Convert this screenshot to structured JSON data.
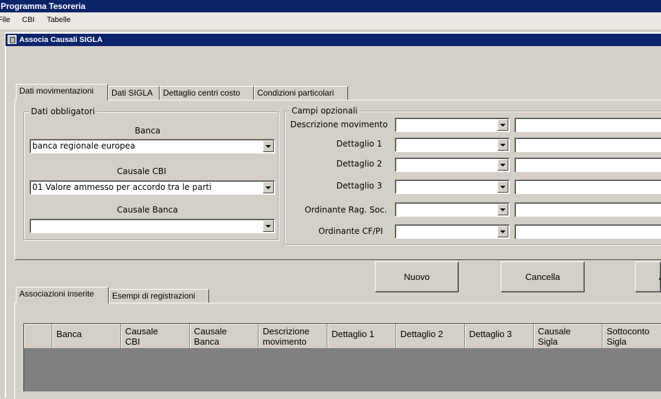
{
  "app": {
    "title": "Programma Tesoreria"
  },
  "menu": {
    "items": [
      "File",
      "CBI",
      "Tabelle"
    ]
  },
  "window": {
    "title": "Associa Causali SIGLA"
  },
  "tabs_top": [
    "Dati movimentazioni",
    "Dati SIGLA",
    "Dettaglio centri costo",
    "Condizioni particolari"
  ],
  "mandatory": {
    "title": "Dati obbligatori",
    "banca_label": "Banca",
    "banca_value": "banca  regionale europea",
    "causale_cbi_label": "Causale CBI",
    "causale_cbi_value": "01 Valore ammesso per accordo tra le parti",
    "causale_banca_label": "Causale Banca",
    "causale_banca_value": ""
  },
  "optional": {
    "title": "Campi opzionali",
    "rows": [
      {
        "label": "Descrizione movimento"
      },
      {
        "label": "Dettaglio 1"
      },
      {
        "label": "Dettaglio 2"
      },
      {
        "label": "Dettaglio 3"
      },
      {
        "label": "Ordinante Rag. Soc."
      },
      {
        "label": "Ordinante CF/PI"
      }
    ]
  },
  "buttons": {
    "nuovo": "Nuovo",
    "cancella": "Cancella",
    "third_partial": "A"
  },
  "tabs_bottom": [
    "Associazioni inserite",
    "Esempi di registrazioni"
  ],
  "grid": {
    "headers": [
      "",
      "Banca",
      "Causale\nCBI",
      "Causale\nBanca",
      "Descrizione\nmovimento",
      "Dettaglio 1",
      "Dettaglio 2",
      "Dettaglio 3",
      "Causale\nSigla",
      "Sottoconto\nSigla"
    ]
  }
}
